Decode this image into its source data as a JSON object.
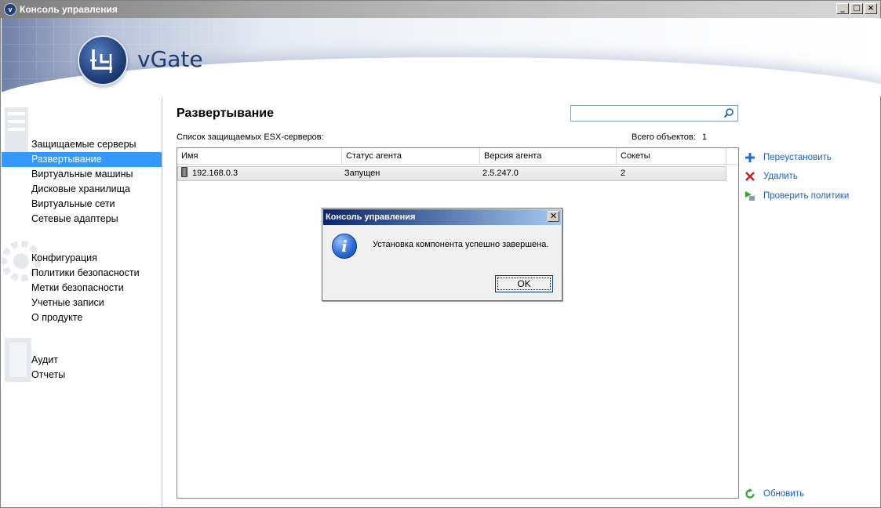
{
  "window": {
    "title": "Консоль управления"
  },
  "brand": {
    "name": "vGate"
  },
  "nav": {
    "groups": [
      {
        "items": [
          "Защищаемые серверы",
          "Развертывание",
          "Виртуальные машины",
          "Дисковые хранилища",
          "Виртуальные сети",
          "Сетевые адаптеры"
        ]
      },
      {
        "items": [
          "Конфигурация",
          "Политики безопасности",
          "Метки безопасности",
          "Учетные записи",
          "О продукте"
        ]
      },
      {
        "items": [
          "Аудит",
          "Отчеты"
        ]
      }
    ],
    "active": "Развертывание"
  },
  "page": {
    "title": "Развертывание",
    "search_value": "",
    "list_caption": "Список защищаемых ESX-серверов:",
    "total_label": "Всего объектов:",
    "total_count": "1"
  },
  "table": {
    "columns": [
      "Имя",
      "Статус агента",
      "Версия агента",
      "Сокеты"
    ],
    "rows": [
      {
        "name": "192.168.0.3",
        "status": "Запущен",
        "version": "2.5.247.0",
        "sockets": "2"
      }
    ]
  },
  "actions": {
    "reinstall": "Переустановить",
    "delete": "Удалить",
    "check_policies": "Проверить политики",
    "refresh": "Обновить"
  },
  "dialog": {
    "title": "Консоль управления",
    "message": "Установка компонента успешно завершена.",
    "ok": "OK",
    "close_glyph": "✕"
  },
  "colors": {
    "accent": "#3399ff",
    "link": "#1c5fbd",
    "brand": "#1e3c72"
  }
}
